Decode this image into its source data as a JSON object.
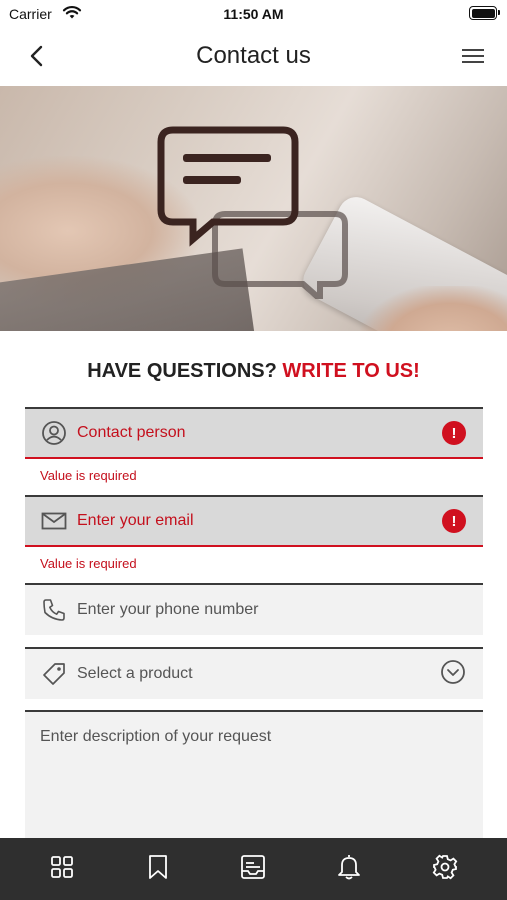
{
  "status_bar": {
    "carrier": "Carrier",
    "time": "11:50 AM",
    "battery_level": 1.0
  },
  "nav": {
    "title": "Contact us",
    "back_icon": "chevron-left-icon",
    "menu_icon": "hamburger-menu-icon"
  },
  "hero": {
    "image": "hands-laptop-phone-photo",
    "overlay_icon": "chat-bubbles-icon"
  },
  "headline": {
    "part1": "HAVE QUESTIONS?",
    "part2": "WRITE TO US!"
  },
  "form": {
    "contact_person": {
      "placeholder": "Contact person",
      "error": "Value is required",
      "icon": "user-circle-icon"
    },
    "email": {
      "placeholder": "Enter your email",
      "error": "Value is required",
      "icon": "envelope-icon"
    },
    "phone": {
      "placeholder": "Enter your phone number",
      "icon": "phone-icon"
    },
    "product": {
      "placeholder": "Select a product",
      "icon": "tag-icon",
      "dropdown_icon": "chevron-down-circle-icon"
    },
    "description": {
      "placeholder": "Enter description of your request"
    },
    "error_badge": "!"
  },
  "tab_bar": {
    "items": [
      {
        "icon": "grid-icon"
      },
      {
        "icon": "bookmark-icon"
      },
      {
        "icon": "news-icon"
      },
      {
        "icon": "bell-icon"
      },
      {
        "icon": "gear-icon"
      }
    ]
  },
  "colors": {
    "accent": "#d0101f",
    "field_bg": "#f2f2f2",
    "field_error_bg": "#d9d9d9",
    "tab_bar_bg": "#2f2f2f"
  }
}
